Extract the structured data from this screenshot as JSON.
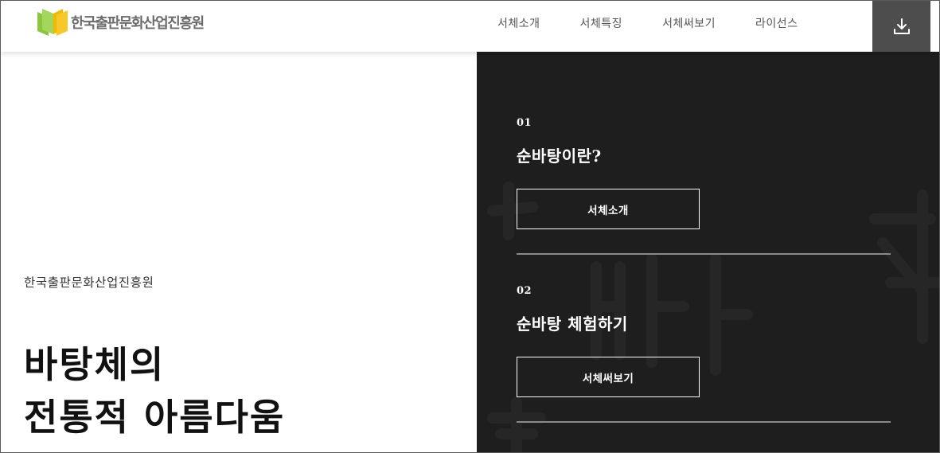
{
  "header": {
    "logo_text": "한국출판문화산업진흥원",
    "nav": [
      "서체소개",
      "서체특징",
      "서체써보기",
      "라이선스"
    ],
    "download_icon": "download-icon"
  },
  "intro": {
    "org_name": "한국출판문화산업진흥원",
    "headline_line1": "바탕체의",
    "headline_line2": "전통적 아름다움"
  },
  "sections": [
    {
      "num": "01",
      "title": "순바탕이란?",
      "button": "서체소개"
    },
    {
      "num": "02",
      "title": "순바탕 체험하기",
      "button": "서체써보기"
    }
  ],
  "colors": {
    "panel_bg": "#1e1e1e",
    "download_bg": "#4d4d4d",
    "logo_green": "#8cc63f",
    "logo_yellow": "#f5b800"
  }
}
